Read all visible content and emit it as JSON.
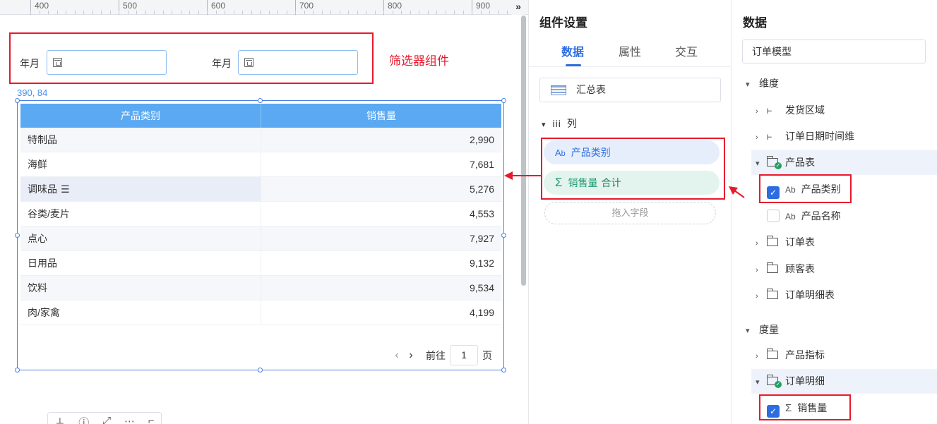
{
  "ruler": {
    "labels": [
      "400",
      "500",
      "600",
      "700",
      "800",
      "900"
    ],
    "expand_icon": "double-chevron-right-icon"
  },
  "filter": {
    "label_1": "年月",
    "label_2": "年月",
    "annotation": "筛选器组件"
  },
  "coords": "390, 84",
  "table": {
    "columns": [
      "产品类别",
      "销售量"
    ],
    "rows": [
      {
        "category": "特制品",
        "value": "2,990"
      },
      {
        "category": "海鲜",
        "value": "7,681"
      },
      {
        "category": "调味品",
        "value": "5,276"
      },
      {
        "category": "谷类/麦片",
        "value": "4,553"
      },
      {
        "category": "点心",
        "value": "7,927"
      },
      {
        "category": "日用品",
        "value": "9,132"
      },
      {
        "category": "饮料",
        "value": "9,534"
      },
      {
        "category": "肉/家禽",
        "value": "4,199"
      }
    ],
    "row_menu_glyph": "☰",
    "pager": {
      "goto_label": "前往",
      "page": "1",
      "page_suffix": "页"
    }
  },
  "settings": {
    "title": "组件设置",
    "tabs": [
      "数据",
      "属性",
      "交互"
    ],
    "active_tab": "数据",
    "chart_type": "汇总表",
    "columns_section": "列",
    "dimension_field": "产品类别",
    "measure_field": "销售量",
    "measure_agg": "合计",
    "drop_placeholder": "拖入字段"
  },
  "data_panel": {
    "title": "数据",
    "model": "订单模型",
    "dimension_group": "维度",
    "dimension_items": [
      "发货区域",
      "订单日期时间维"
    ],
    "product_table": "产品表",
    "product_fields": [
      {
        "label": "产品类别",
        "checked": true
      },
      {
        "label": "产品名称",
        "checked": false
      }
    ],
    "other_tables": [
      "订单表",
      "顾客表",
      "订单明细表"
    ],
    "measure_group": "度量",
    "measure_items": [
      "产品指标"
    ],
    "order_detail": "订单明细",
    "measure_fields": [
      {
        "label": "销售量",
        "checked": true
      }
    ]
  },
  "colors": {
    "accent": "#2d6de0",
    "table_header": "#5aa9f2",
    "annotation_red": "#e8192c",
    "measure_green": "#1b9a6d"
  }
}
